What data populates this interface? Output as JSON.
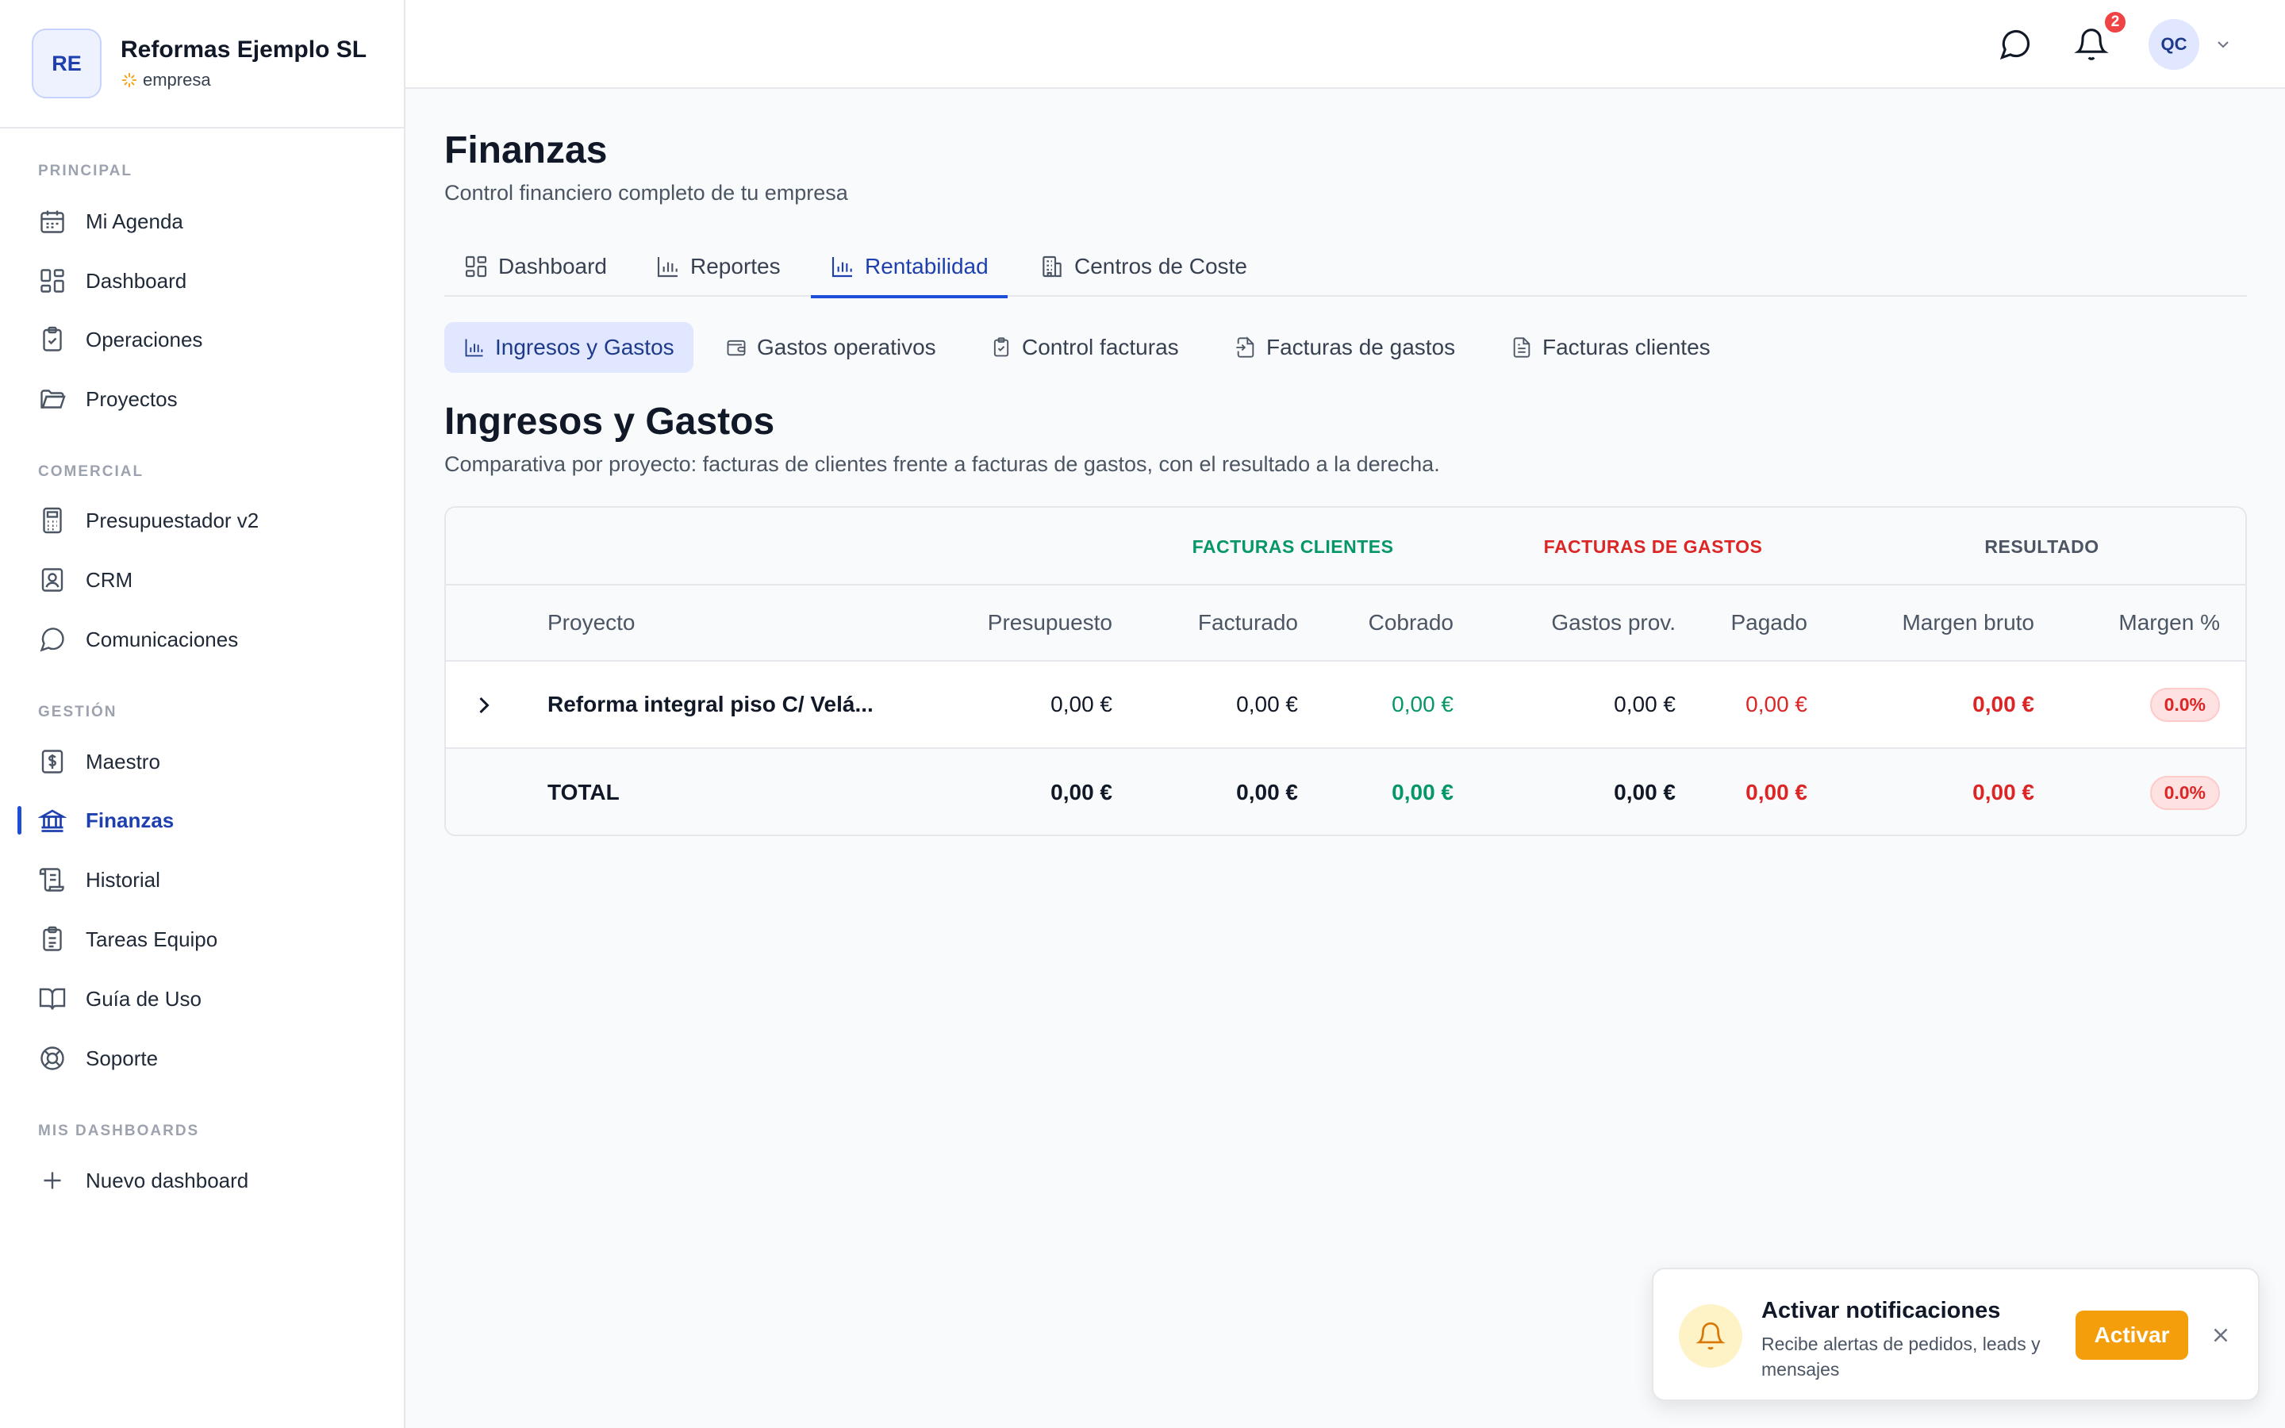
{
  "brand": {
    "initials": "RE",
    "name": "Reformas Ejemplo SL",
    "plan": "empresa"
  },
  "sidebar": {
    "sections": [
      {
        "title": "PRINCIPAL",
        "items": [
          "Mi Agenda",
          "Dashboard",
          "Operaciones",
          "Proyectos"
        ]
      },
      {
        "title": "COMERCIAL",
        "items": [
          "Presupuestador v2",
          "CRM",
          "Comunicaciones"
        ]
      },
      {
        "title": "GESTIÓN",
        "items": [
          "Maestro",
          "Finanzas",
          "Historial",
          "Tareas Equipo",
          "Guía de Uso",
          "Soporte"
        ]
      },
      {
        "title": "MIS DASHBOARDS",
        "items": [
          "Nuevo dashboard"
        ]
      }
    ],
    "active_item": "Finanzas"
  },
  "topbar": {
    "notification_count": "2",
    "user_initials": "QC"
  },
  "page": {
    "title": "Finanzas",
    "subtitle": "Control financiero completo de tu empresa"
  },
  "tabs": [
    "Dashboard",
    "Reportes",
    "Rentabilidad",
    "Centros de Coste"
  ],
  "active_tab": "Rentabilidad",
  "subtabs": [
    "Ingresos y Gastos",
    "Gastos operativos",
    "Control facturas",
    "Facturas de gastos",
    "Facturas clientes"
  ],
  "active_subtab": "Ingresos y Gastos",
  "section": {
    "title": "Ingresos y Gastos",
    "description": "Comparativa por proyecto: facturas de clientes frente a facturas de gastos, con el resultado a la derecha."
  },
  "table": {
    "groups": {
      "clients": "FACTURAS CLIENTES",
      "expenses": "FACTURAS DE GASTOS",
      "result": "RESULTADO"
    },
    "columns": {
      "project": "Proyecto",
      "budget": "Presupuesto",
      "invoiced": "Facturado",
      "collected": "Cobrado",
      "supplier_costs": "Gastos prov.",
      "paid": "Pagado",
      "gross_margin": "Margen bruto",
      "margin_pct": "Margen %"
    },
    "rows": [
      {
        "project": "Reforma integral piso C/ Velá...",
        "budget": "0,00 €",
        "invoiced": "0,00 €",
        "collected": "0,00 €",
        "supplier_costs": "0,00 €",
        "paid": "0,00 €",
        "gross_margin": "0,00 €",
        "margin_pct": "0.0%"
      }
    ],
    "total": {
      "label": "TOTAL",
      "budget": "0,00 €",
      "invoiced": "0,00 €",
      "collected": "0,00 €",
      "supplier_costs": "0,00 €",
      "paid": "0,00 €",
      "gross_margin": "0,00 €",
      "margin_pct": "0.0%"
    }
  },
  "toast": {
    "title": "Activar notificaciones",
    "body": "Recibe alertas de pedidos, leads y mensajes",
    "button": "Activar"
  },
  "colors": {
    "accent": "#1d4ed8",
    "positive": "#059669",
    "negative": "#dc2626",
    "warning": "#f59e0b"
  }
}
